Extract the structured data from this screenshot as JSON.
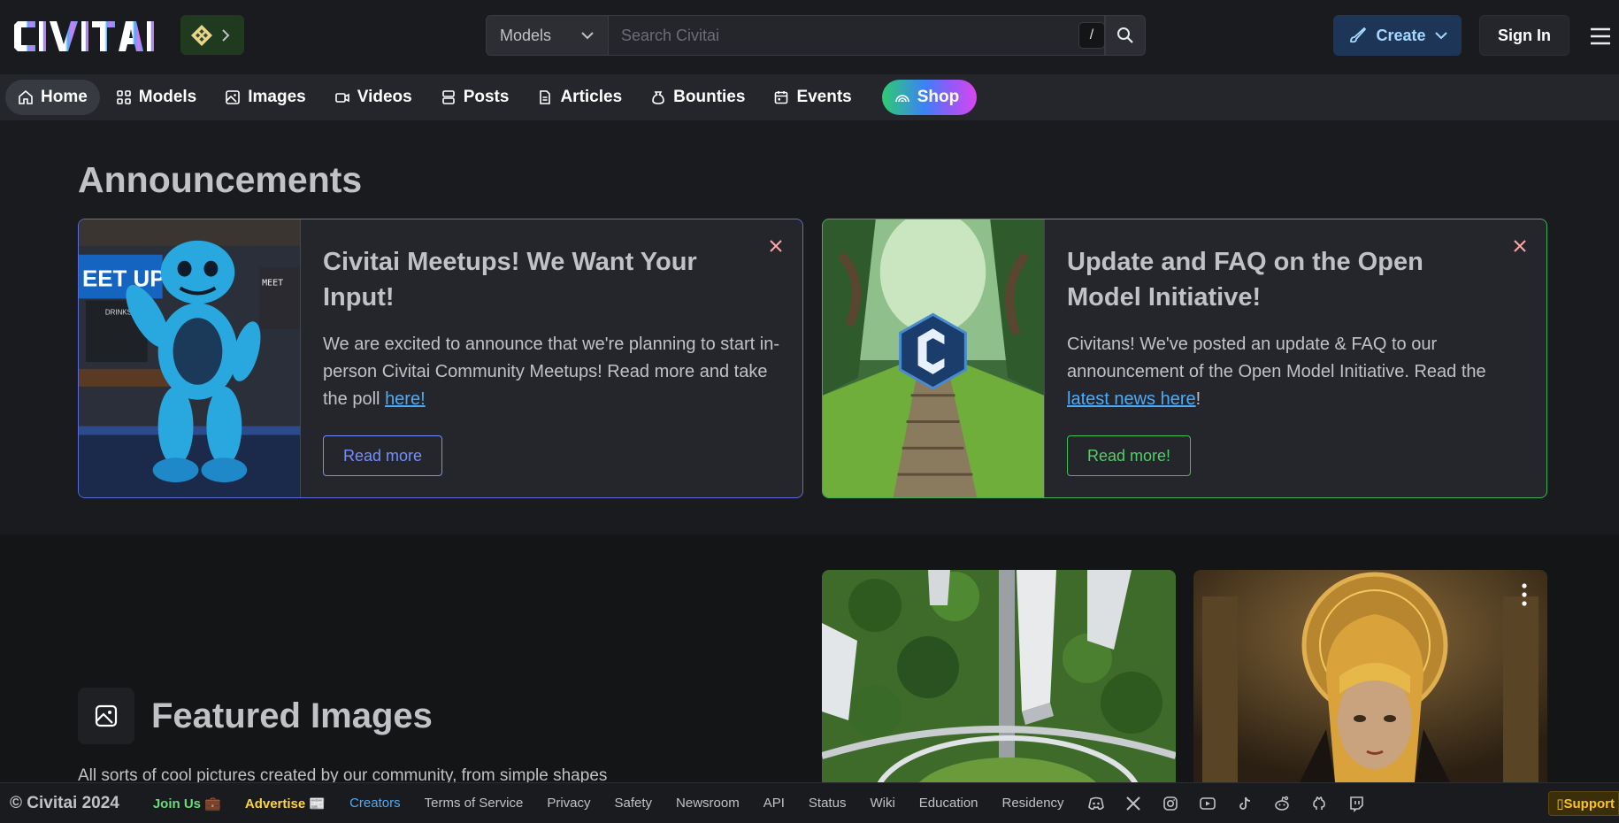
{
  "header": {
    "logo_text": "CIVITAI",
    "search_type": "Models",
    "search_placeholder": "Search Civitai",
    "search_shortcut": "/",
    "create_label": "Create",
    "signin_label": "Sign In"
  },
  "nav": {
    "items": [
      {
        "label": "Home",
        "icon": "home-icon",
        "active": true
      },
      {
        "label": "Models",
        "icon": "grid-icon"
      },
      {
        "label": "Images",
        "icon": "image-icon"
      },
      {
        "label": "Videos",
        "icon": "video-icon"
      },
      {
        "label": "Posts",
        "icon": "posts-icon"
      },
      {
        "label": "Articles",
        "icon": "article-icon"
      },
      {
        "label": "Bounties",
        "icon": "moneybag-icon"
      },
      {
        "label": "Events",
        "icon": "calendar-icon"
      }
    ],
    "shop_label": "Shop"
  },
  "announcements": {
    "title": "Announcements",
    "cards": [
      {
        "title": "Civitai Meetups! We Want Your Input!",
        "text_before": "We are excited to announce that we're planning to start in-person Civitai Community Meetups! Read more and take the poll ",
        "link": "here!",
        "text_after": "",
        "button": "Read more",
        "accent": "#5c6bd6"
      },
      {
        "title": "Update and FAQ on the Open Model Initiative!",
        "text_before": "Civitans! We've posted an update & FAQ to our announcement of the Open Model Initiative. Read the ",
        "link": "latest news here",
        "text_after": "!",
        "button": "Read more!",
        "accent": "#3fae5a"
      }
    ]
  },
  "featured": {
    "title": "Featured Images",
    "description": "All sorts of cool pictures created by our community, from simple shapes"
  },
  "footer": {
    "copyright": "© Civitai 2024",
    "join": "Join Us 💼",
    "advertise": "Advertise 📰",
    "creators": "Creators",
    "links": [
      "Terms of Service",
      "Privacy",
      "Safety",
      "Newsroom",
      "API",
      "Status",
      "Wiki",
      "Education",
      "Residency"
    ],
    "social_icons": [
      "discord-icon",
      "x-icon",
      "instagram-icon",
      "youtube-icon",
      "tiktok-icon",
      "reddit-icon",
      "github-icon",
      "twitch-icon"
    ],
    "support": "Support"
  }
}
